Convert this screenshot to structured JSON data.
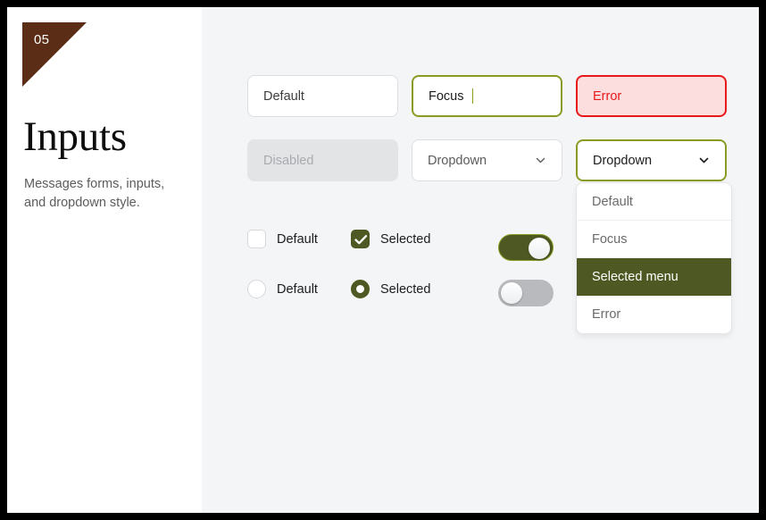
{
  "sidebar": {
    "badge_number": "05",
    "title": "Inputs",
    "description": "Messages forms, inputs, and dropdown style."
  },
  "fields": {
    "default": {
      "text": "Default",
      "state": "default"
    },
    "focus": {
      "text": "Focus",
      "state": "focus"
    },
    "error": {
      "text": "Error",
      "state": "error"
    },
    "disabled": {
      "text": "Disabled",
      "state": "disabled"
    },
    "dropdown_default": {
      "text": "Dropdown",
      "state": "default",
      "icon": "chevron-down-icon"
    },
    "dropdown_focus": {
      "text": "Dropdown",
      "state": "focus",
      "icon": "chevron-down-icon"
    }
  },
  "dropdown_menu": {
    "items": [
      {
        "label": "Default",
        "selected": false
      },
      {
        "label": "Focus",
        "selected": false
      },
      {
        "label": "Selected menu",
        "selected": true
      },
      {
        "label": "Error",
        "selected": false
      }
    ]
  },
  "checkboxes": [
    {
      "label": "Default",
      "checked": false
    },
    {
      "label": "Selected",
      "checked": true
    }
  ],
  "radios": [
    {
      "label": "Default",
      "selected": false
    },
    {
      "label": "Selected",
      "selected": true
    }
  ],
  "toggles": [
    {
      "state": "on"
    },
    {
      "state": "off"
    }
  ],
  "colors": {
    "accent": "#4e5822",
    "accent_border": "#8a9a23",
    "error": "#e8191b",
    "error_fill": "#fcdede",
    "badge_brown": "#5b2d17",
    "canvas": "#f4f5f7",
    "sidebar": "#ffffff"
  }
}
